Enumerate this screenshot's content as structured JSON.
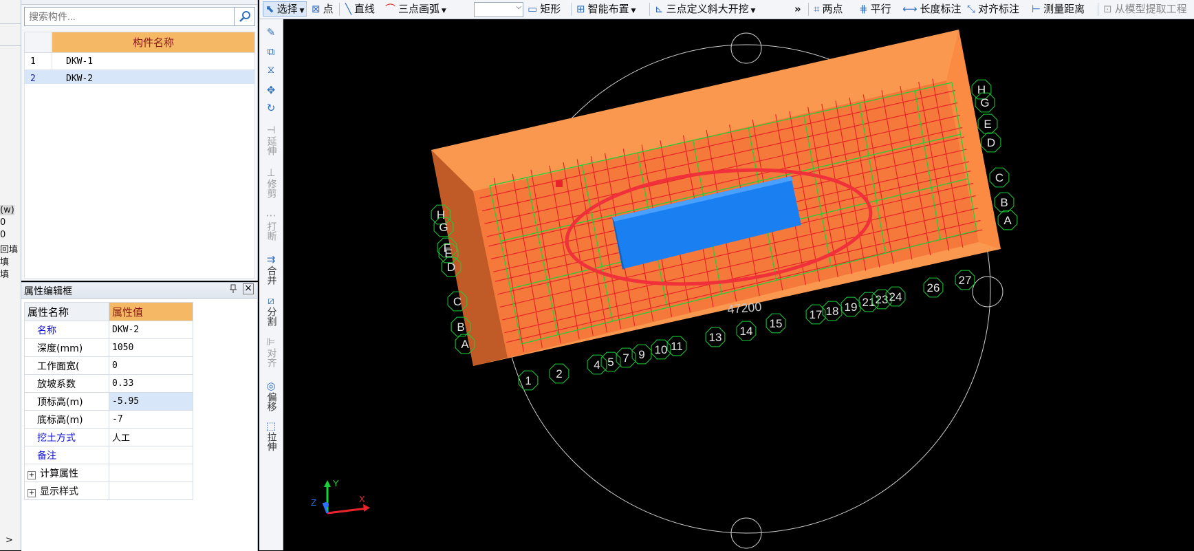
{
  "left_strip": {
    "items": [
      "(w)",
      "0",
      "0",
      "回填",
      "填",
      "填"
    ],
    "arrow": ">"
  },
  "component_panel": {
    "search_placeholder": "搜索构件...",
    "header": "构件名称",
    "rows": [
      {
        "index": "1",
        "name": "DKW-1"
      },
      {
        "index": "2",
        "name": "DKW-2"
      }
    ]
  },
  "property_panel": {
    "title": "属性编辑框",
    "pin": "ᵖ",
    "close": "×",
    "col_name": "属性名称",
    "col_value": "属性值",
    "rows": [
      {
        "name": "名称",
        "value": "DKW-2"
      },
      {
        "name": "深度(mm)",
        "value": "1050"
      },
      {
        "name": "工作面宽(",
        "value": "0"
      },
      {
        "name": "放坡系数",
        "value": "0.33"
      },
      {
        "name": "顶标高(m)",
        "value": "-5.95"
      },
      {
        "name": "底标高(m)",
        "value": "-7"
      },
      {
        "name": "挖土方式",
        "value": "人工"
      },
      {
        "name": "备注",
        "value": ""
      },
      {
        "name": "计算属性",
        "value": ""
      },
      {
        "name": "显示样式",
        "value": ""
      }
    ]
  },
  "toolbar": {
    "select": "选择",
    "point": "点",
    "line": "直线",
    "arc": "三点画弧",
    "rect": "矩形",
    "smart": "智能布置",
    "slope": "三点定义斜大开挖",
    "more": "»",
    "two_point": "两点",
    "parallel": "平行",
    "length_dim": "长度标注",
    "align_dim": "对齐标注",
    "measure": "测量距离",
    "extract": "从模型提取工程"
  },
  "vertical_tools": {
    "extend": "延伸",
    "trim": "修剪",
    "break": "打断",
    "merge": "合并",
    "split": "分割",
    "align": "对齐",
    "offset": "偏移",
    "stretch": "拉伸"
  },
  "canvas": {
    "dimension": "47200",
    "axis_numbers": [
      "1",
      "2",
      "4",
      "5",
      "7",
      "9",
      "10",
      "11",
      "13",
      "14",
      "15",
      "17",
      "18",
      "19",
      "21",
      "23",
      "24",
      "26",
      "27"
    ],
    "axis_letters_right": [
      "H",
      "G",
      "E",
      "D",
      "C",
      "B",
      "A"
    ],
    "axis_letters_left": [
      "H",
      "G",
      "F",
      "E",
      "D",
      "C",
      "B",
      "A"
    ],
    "ucs": {
      "x": "X",
      "y": "Y",
      "z": "Z"
    },
    "colors": {
      "pit": "#f5883a",
      "pit_top": "#fb9a50",
      "pit_side": "#c25d26",
      "pool": "#1a7ff0",
      "grid": "#e8242a",
      "axis": "#19d238",
      "highlight": "#f0303a"
    }
  }
}
